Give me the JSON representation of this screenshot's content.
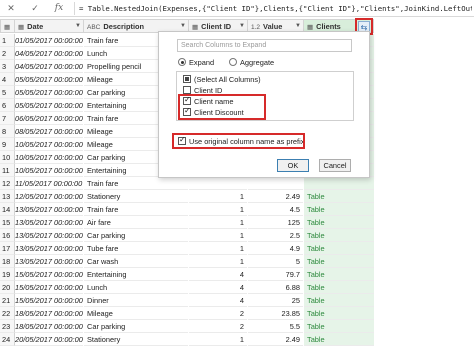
{
  "formula_bar": {
    "close_glyph": "✕",
    "check_glyph": "✓",
    "fx_label": "fx",
    "formula": "= Table.NestedJoin(Expenses,{\"Client ID\"},Clients,{\"Client ID\"},\"Clients\",JoinKind.LeftOuter)"
  },
  "columns": [
    {
      "type_icon": "▦",
      "label": "",
      "name": "table-menu"
    },
    {
      "type_icon": "▦",
      "label": "Date",
      "name": "date"
    },
    {
      "type_icon": "ABC",
      "label": "Description",
      "name": "description"
    },
    {
      "type_icon": "▦",
      "label": "Client ID",
      "name": "client-id"
    },
    {
      "type_icon": "1.2",
      "label": "Value",
      "name": "value"
    },
    {
      "type_icon": "▦",
      "label": "Clients",
      "name": "clients"
    }
  ],
  "rows": [
    {
      "n": "1",
      "date": "01/05/2017 00:00:00",
      "desc": "Train fare",
      "cid": "",
      "val": "",
      "cli": ""
    },
    {
      "n": "2",
      "date": "04/05/2017 00:00:00",
      "desc": "Lunch",
      "cid": "",
      "val": "",
      "cli": ""
    },
    {
      "n": "3",
      "date": "04/05/2017 00:00:00",
      "desc": "Propelling pencil",
      "cid": "",
      "val": "",
      "cli": ""
    },
    {
      "n": "4",
      "date": "05/05/2017 00:00:00",
      "desc": "Mileage",
      "cid": "",
      "val": "",
      "cli": ""
    },
    {
      "n": "5",
      "date": "05/05/2017 00:00:00",
      "desc": "Car parking",
      "cid": "",
      "val": "",
      "cli": ""
    },
    {
      "n": "6",
      "date": "05/05/2017 00:00:00",
      "desc": "Entertaining",
      "cid": "",
      "val": "",
      "cli": ""
    },
    {
      "n": "7",
      "date": "06/05/2017 00:00:00",
      "desc": "Train fare",
      "cid": "",
      "val": "",
      "cli": ""
    },
    {
      "n": "8",
      "date": "08/05/2017 00:00:00",
      "desc": "Mileage",
      "cid": "",
      "val": "",
      "cli": ""
    },
    {
      "n": "9",
      "date": "10/05/2017 00:00:00",
      "desc": "Mileage",
      "cid": "",
      "val": "",
      "cli": ""
    },
    {
      "n": "10",
      "date": "10/05/2017 00:00:00",
      "desc": "Car parking",
      "cid": "",
      "val": "",
      "cli": ""
    },
    {
      "n": "11",
      "date": "10/05/2017 00:00:00",
      "desc": "Entertaining",
      "cid": "",
      "val": "",
      "cli": ""
    },
    {
      "n": "12",
      "date": "11/05/2017 00:00:00",
      "desc": "Train fare",
      "cid": "",
      "val": "",
      "cli": ""
    },
    {
      "n": "13",
      "date": "12/05/2017 00:00:00",
      "desc": "Stationery",
      "cid": "1",
      "val": "2.49",
      "cli": "Table"
    },
    {
      "n": "14",
      "date": "13/05/2017 00:00:00",
      "desc": "Train fare",
      "cid": "1",
      "val": "4.5",
      "cli": "Table"
    },
    {
      "n": "15",
      "date": "13/05/2017 00:00:00",
      "desc": "Air fare",
      "cid": "1",
      "val": "125",
      "cli": "Table"
    },
    {
      "n": "16",
      "date": "13/05/2017 00:00:00",
      "desc": "Car parking",
      "cid": "1",
      "val": "2.5",
      "cli": "Table"
    },
    {
      "n": "17",
      "date": "13/05/2017 00:00:00",
      "desc": "Tube fare",
      "cid": "1",
      "val": "4.9",
      "cli": "Table"
    },
    {
      "n": "18",
      "date": "13/05/2017 00:00:00",
      "desc": "Car wash",
      "cid": "1",
      "val": "5",
      "cli": "Table"
    },
    {
      "n": "19",
      "date": "15/05/2017 00:00:00",
      "desc": "Entertaining",
      "cid": "4",
      "val": "79.7",
      "cli": "Table"
    },
    {
      "n": "20",
      "date": "15/05/2017 00:00:00",
      "desc": "Lunch",
      "cid": "4",
      "val": "6.88",
      "cli": "Table"
    },
    {
      "n": "21",
      "date": "15/05/2017 00:00:00",
      "desc": "Dinner",
      "cid": "4",
      "val": "25",
      "cli": "Table"
    },
    {
      "n": "22",
      "date": "18/05/2017 00:00:00",
      "desc": "Mileage",
      "cid": "2",
      "val": "23.85",
      "cli": "Table"
    },
    {
      "n": "23",
      "date": "18/05/2017 00:00:00",
      "desc": "Car parking",
      "cid": "2",
      "val": "5.5",
      "cli": "Table"
    },
    {
      "n": "24",
      "date": "20/05/2017 00:00:00",
      "desc": "Stationery",
      "cid": "1",
      "val": "2.49",
      "cli": "Table"
    }
  ],
  "popup": {
    "search_placeholder": "Search Columns to Expand",
    "expand_label": "Expand",
    "aggregate_label": "Aggregate",
    "select_all_label": "(Select All Columns)",
    "columns": [
      {
        "label": "Client ID",
        "checked": false
      },
      {
        "label": "Client name",
        "checked": true
      },
      {
        "label": "Client Discount",
        "checked": true
      }
    ],
    "prefix_label": "Use original column name as prefix",
    "ok_label": "OK",
    "cancel_label": "Cancel"
  },
  "colors": {
    "highlight": "#d62a2a",
    "table_link": "#2f8a3f",
    "clients_header": "#d8eedb"
  }
}
